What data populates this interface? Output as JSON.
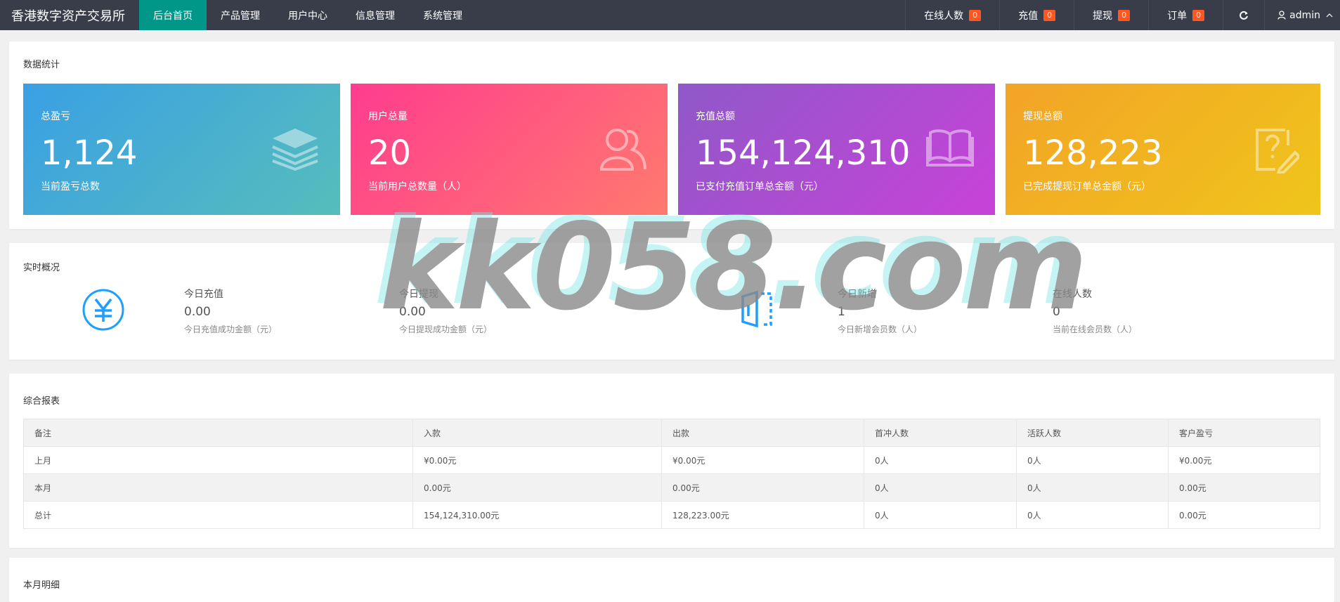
{
  "app": {
    "title": "香港数字资产交易所"
  },
  "nav": {
    "items": [
      {
        "label": "后台首页",
        "active": true
      },
      {
        "label": "产品管理"
      },
      {
        "label": "用户中心"
      },
      {
        "label": "信息管理"
      },
      {
        "label": "系统管理"
      }
    ],
    "right": [
      {
        "label": "在线人数",
        "count": "0"
      },
      {
        "label": "充值",
        "count": "0"
      },
      {
        "label": "提现",
        "count": "0"
      },
      {
        "label": "订单",
        "count": "0"
      }
    ],
    "refresh_icon": "refresh-icon",
    "user": {
      "name": "admin",
      "icon": "user-icon"
    }
  },
  "stats": {
    "title": "数据统计",
    "boxes": [
      {
        "label": "总盈亏",
        "value": "1,124",
        "desc": "当前盈亏总数",
        "icon": "layers-icon",
        "colors": [
          "#3aa0e4",
          "#56bdbc"
        ]
      },
      {
        "label": "用户总量",
        "value": "20",
        "desc": "当前用户总数量（人）",
        "icon": "users-icon",
        "colors": [
          "#ff3c8e",
          "#ff7a6e"
        ]
      },
      {
        "label": "充值总额",
        "value": "154,124,310",
        "desc": "已支付充值订单总金额（元）",
        "icon": "book-icon",
        "colors": [
          "#8f59c9",
          "#c842d8"
        ]
      },
      {
        "label": "提现总额",
        "value": "128,223",
        "desc": "已完成提现订单总金额（元）",
        "icon": "question-edit-icon",
        "colors": [
          "#f3a427",
          "#efc51b"
        ]
      }
    ]
  },
  "realtime": {
    "title": "实时概况",
    "items": [
      {
        "label": "今日充值",
        "value": "0.00",
        "desc": "今日充值成功金额（元）"
      },
      {
        "label": "今日提现",
        "value": "0.00",
        "desc": "今日提现成功金额（元）"
      },
      {
        "label": "今日新增",
        "value": "1",
        "desc": "今日新增会员数（人）"
      },
      {
        "label": "在线人数",
        "value": "0",
        "desc": "当前在线会员数（人）"
      }
    ],
    "icons": [
      "yen-icon",
      "exit-door-icon"
    ]
  },
  "report": {
    "title": "综合报表",
    "columns": [
      "备注",
      "入款",
      "出款",
      "首冲人数",
      "活跃人数",
      "客户盈亏"
    ],
    "rows": [
      [
        "上月",
        "¥0.00元",
        "¥0.00元",
        "0人",
        "0人",
        "¥0.00元"
      ],
      [
        "本月",
        "0.00元",
        "0.00元",
        "0人",
        "0人",
        "0.00元"
      ],
      [
        "总计",
        "154,124,310.00元",
        "128,223.00元",
        "0人",
        "0人",
        "0.00元"
      ]
    ]
  },
  "monthly": {
    "title": "本月明细"
  },
  "watermark": "kk058.com"
}
